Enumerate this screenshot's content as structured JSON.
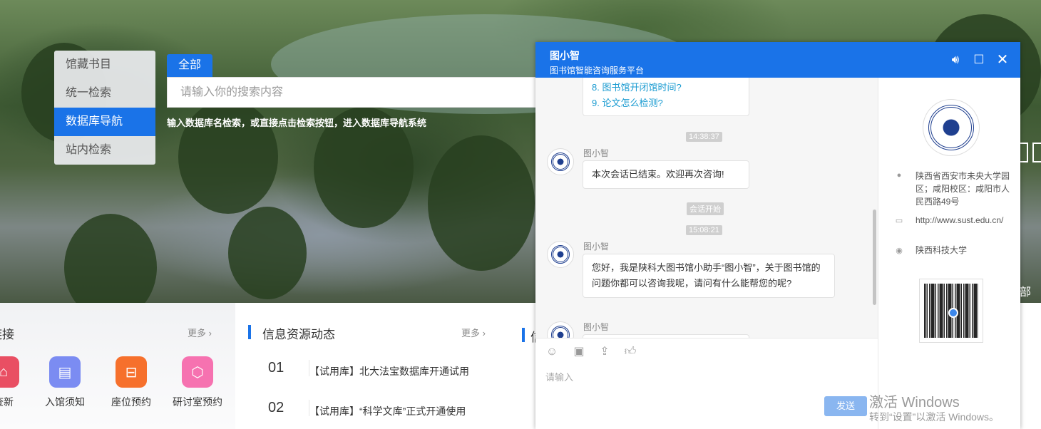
{
  "menu": {
    "items": [
      "馆藏书目",
      "统一检索",
      "数据库导航",
      "站内检索"
    ],
    "active_index": 2
  },
  "search": {
    "tab_label": "全部",
    "placeholder": "请输入你的搜索内容",
    "hint": "输入数据库名检索，或直接点击检索按钮，进入数据库导航系统"
  },
  "links_section": {
    "title": "链接",
    "more": "更多 ›",
    "items": [
      {
        "label": "查新",
        "color": "#e94f63",
        "icon": "partial-icon"
      },
      {
        "label": "入馆须知",
        "color": "#7b8cf2",
        "icon": "document-icon"
      },
      {
        "label": "座位预约",
        "color": "#f6702c",
        "icon": "seat-icon"
      },
      {
        "label": "研讨室预约",
        "color": "#f672b0",
        "icon": "cube-icon"
      }
    ]
  },
  "news_section": {
    "title": "信息资源动态",
    "more": "更多 ›",
    "items": [
      {
        "num": "01",
        "text": "【试用库】北大法宝数据库开通试用"
      },
      {
        "num": "02",
        "text": "【试用库】“科学文库”正式开通使用"
      }
    ]
  },
  "third_section_partial": "信",
  "edge_text": "部提",
  "chat": {
    "title": "图小智",
    "subtitle": "图书馆智能咨询服务平台",
    "header_icons": [
      "speaker-icon",
      "maximize-icon",
      "close-icon"
    ],
    "messages": [
      {
        "type": "links",
        "lines": [
          "8. 图书馆开闭馆时间?",
          "9. 论文怎么检测?"
        ]
      },
      {
        "type": "time",
        "text": "14:38:37"
      },
      {
        "type": "bot",
        "name": "图小智",
        "text": "本次会话已结束。欢迎再次咨询!"
      },
      {
        "type": "system",
        "text": "会话开始"
      },
      {
        "type": "time",
        "text": "15:08:21"
      },
      {
        "type": "bot",
        "name": "图小智",
        "text": "您好，我是陕科大图书馆小助手“图小智”，关于图书馆的问题你都可以咨询我呢，请问有什么能帮您的呢?"
      },
      {
        "type": "bot",
        "name": "图小智",
        "text": ""
      }
    ],
    "toolbar_icons": [
      "emoji-icon",
      "image-icon",
      "upload-icon",
      "thumbs-up-icon"
    ],
    "input_placeholder": "请输入",
    "send_label": "发送",
    "sidebar": {
      "address": "陕西省西安市未央大学园区；咸阳校区：咸阳市人民西路49号",
      "website": "http://www.sust.edu.cn/",
      "wechat": "陕西科技大学"
    }
  },
  "watermark": {
    "line1": "激活 Windows",
    "line2": "转到“设置”以激活 Windows。"
  }
}
